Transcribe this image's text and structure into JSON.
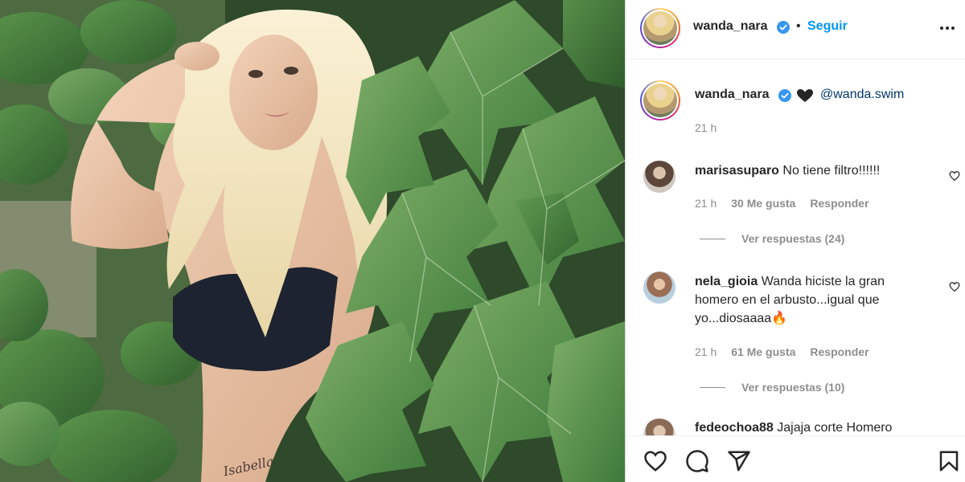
{
  "post": {
    "author": "wanda_nara",
    "follow_label": "Seguir",
    "separator": "•",
    "caption_mention": "@wanda.swim",
    "caption_time": "21 h"
  },
  "comments": [
    {
      "username": "marisasuparo",
      "text": "No tiene filtro!!!!!!",
      "time": "21 h",
      "likes": "30 Me gusta",
      "reply_label": "Responder",
      "replies_label": "Ver respuestas (24)"
    },
    {
      "username": "nela_gioia",
      "text_line1": "Wanda hiciste la gran",
      "text_line2": "homero en el arbusto...igual que",
      "text_line3": "yo...diosaaaa🔥",
      "time": "21 h",
      "likes": "61 Me gusta",
      "reply_label": "Responder",
      "replies_label": "Ver respuestas (10)"
    },
    {
      "username": "fedeochoa88",
      "text": "Jajaja corte Homero"
    }
  ],
  "photo": {
    "tattoo_text": "Isabella"
  },
  "icons": {
    "verified": "verified-badge-icon",
    "caption_emoji": "black-heart-icon",
    "like": "heart-outline-icon",
    "comment": "speech-bubble-icon",
    "share": "paper-plane-icon",
    "save": "bookmark-icon",
    "more": "ellipsis-icon"
  },
  "colors": {
    "link": "#0095f6",
    "mention": "#00376b",
    "muted": "#8e8e8e",
    "verified": "#3897f0"
  }
}
